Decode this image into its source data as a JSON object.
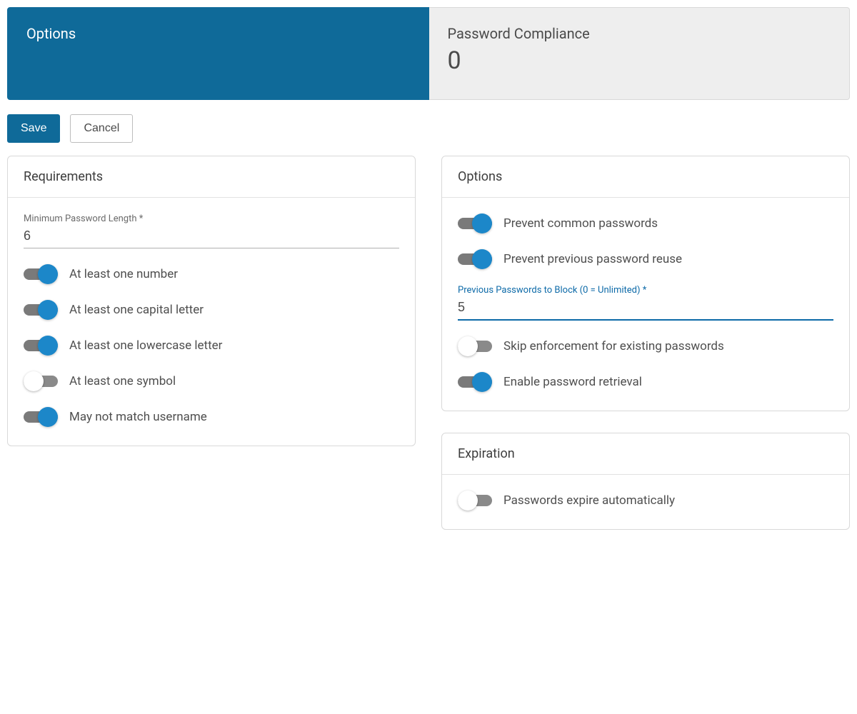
{
  "tabs": {
    "options": {
      "title": "Options"
    },
    "compliance": {
      "title": "Password Compliance",
      "count": "0"
    }
  },
  "buttons": {
    "save": "Save",
    "cancel": "Cancel"
  },
  "requirements": {
    "title": "Requirements",
    "minLength": {
      "label": "Minimum Password Length *",
      "value": "6"
    },
    "toggles": {
      "number": {
        "label": "At least one number",
        "on": true
      },
      "capital": {
        "label": "At least one capital letter",
        "on": true
      },
      "lowercase": {
        "label": "At least one lowercase letter",
        "on": true
      },
      "symbol": {
        "label": "At least one symbol",
        "on": false
      },
      "notUsername": {
        "label": "May not match username",
        "on": true
      }
    }
  },
  "options": {
    "title": "Options",
    "toggles": {
      "common": {
        "label": "Prevent common passwords",
        "on": true
      },
      "reuse": {
        "label": "Prevent previous password reuse",
        "on": true
      },
      "skip": {
        "label": "Skip enforcement for existing passwords",
        "on": false
      },
      "retrieve": {
        "label": "Enable password retrieval",
        "on": true
      }
    },
    "prevBlock": {
      "label": "Previous Passwords to Block (0 = Unlimited) *",
      "value": "5"
    }
  },
  "expiration": {
    "title": "Expiration",
    "toggles": {
      "auto": {
        "label": "Passwords expire automatically",
        "on": false
      }
    }
  }
}
